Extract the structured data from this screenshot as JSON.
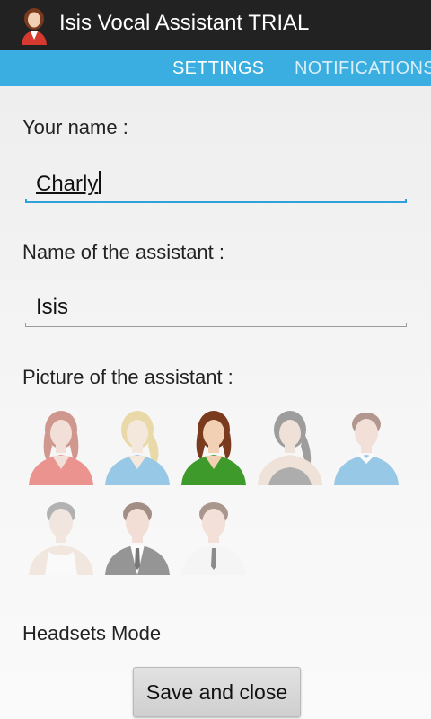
{
  "app": {
    "title": "Isis Vocal Assistant TRIAL",
    "icon": "assistant-woman-icon"
  },
  "tabs": [
    {
      "label": "SETTINGS",
      "selected": true
    },
    {
      "label": "NOTIFICATIONS",
      "selected": false
    }
  ],
  "form": {
    "your_name_label": "Your name :",
    "your_name_value": "Charly",
    "assistant_name_label": "Name of the assistant :",
    "assistant_name_value": "Isis",
    "picture_label": "Picture of the assistant :",
    "avatars": [
      {
        "name": "woman-red-avatar",
        "selected": false
      },
      {
        "name": "woman-blonde-avatar",
        "selected": false
      },
      {
        "name": "woman-green-avatar",
        "selected": true
      },
      {
        "name": "woman-dark-avatar",
        "selected": false
      },
      {
        "name": "man-blue-avatar",
        "selected": false
      },
      {
        "name": "man-tank-top-avatar",
        "selected": false
      },
      {
        "name": "man-suit-avatar",
        "selected": false
      },
      {
        "name": "man-white-shirt-avatar",
        "selected": false
      }
    ],
    "headsets_label": "Headsets Mode",
    "save_label": "Save and close"
  },
  "colors": {
    "accent": "#3aaee0",
    "titlebar": "#222222",
    "focus": "#2fa2d9"
  }
}
